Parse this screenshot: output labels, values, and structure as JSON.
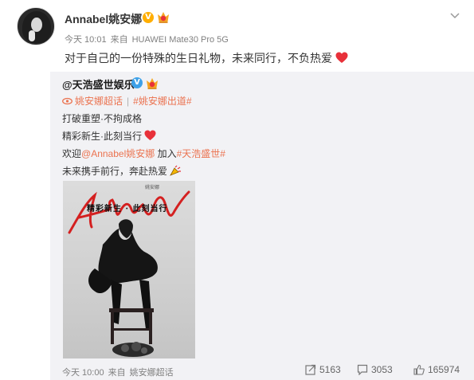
{
  "post": {
    "username": "Annabel姚安娜",
    "verified_badge": "V",
    "time": "今天 10:01",
    "source_prefix": "来自",
    "device": "HUAWEI Mate30 Pro 5G",
    "text": "对于自己的一份特殊的生日礼物，未来同行，不负热爱"
  },
  "repost": {
    "username": "@天浩盛世娱乐",
    "verified_badge": "V",
    "topic1": "姚安娜超话",
    "topic_separator": "|",
    "topic2": "#姚安娜出道#",
    "line1": "打破重塑·不拘成格",
    "line2": "精彩新生·此刻当行",
    "line3_prefix": "欢迎",
    "line3_mention": "@Annabel姚安娜",
    "line3_mid": " 加入",
    "line3_hashtag": "#天浩盛世#",
    "line4": "未来携手前行，奔赴热爱",
    "poster": {
      "small_name": "姚安娜",
      "tagline": "精彩新生 · 此刻当行"
    },
    "time": "今天 10:00",
    "source_prefix": "来自",
    "source": "姚安娜超话",
    "stats": {
      "forwards": "5163",
      "comments": "3053",
      "likes": "165974"
    }
  },
  "colors": {
    "link": "#eb7350",
    "gold_badge": "#ffae00",
    "blue_badge": "#3ea1e8",
    "heart": "#e8313a",
    "repost_bg": "#f2f2f5"
  }
}
